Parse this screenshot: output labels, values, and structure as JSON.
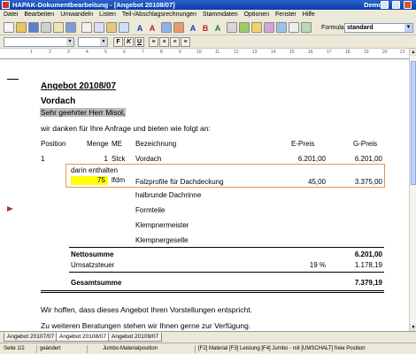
{
  "window": {
    "title": "HAPAK-Dokumentbearbeitung - [Angebot 20108/07]",
    "edition": "Demo"
  },
  "menu": [
    "Datei",
    "Bearbeiten",
    "Umwandeln",
    "Listen",
    "Teil-/Abschlagsrechnungen",
    "Stammdaten",
    "Optionen",
    "Fenster",
    "Hilfe"
  ],
  "toolbar": {
    "formular_label": "Formular",
    "formular_value": "standard",
    "format_buttons": [
      "F",
      "K",
      "U",
      "≡",
      "≡",
      "≡",
      "≡"
    ]
  },
  "ruler_numbers": [
    "1",
    "2",
    "3",
    "4",
    "5",
    "6",
    "7",
    "8",
    "9",
    "10",
    "11",
    "12",
    "13",
    "14",
    "15",
    "16",
    "17",
    "18",
    "19",
    "20",
    "21"
  ],
  "document": {
    "title": "Angebot 20108/07",
    "subject": "Vordach",
    "salutation": "Sehr geehrter Herr Misol,",
    "intro": "wir danken für Ihre Anfrage und bieten wie folgt an:",
    "headers": {
      "position": "Position",
      "quantity": "Menge",
      "unit": "ME",
      "description": "Bezeichnung",
      "unit_price": "E-Preis",
      "total_price": "G-Preis"
    },
    "position1": {
      "position": "1",
      "quantity": "1",
      "unit": "Stck",
      "description": "Vordach",
      "unit_price": "6.201,00",
      "total_price": "6.201,00"
    },
    "included_label": "darin enthalten",
    "subposition": {
      "quantity": "75",
      "unit": "lfdm",
      "description": "Falzprofile für Dachdeckung",
      "unit_price": "45,00",
      "total_price": "3.375,00"
    },
    "sub_items": [
      "halbrunde Dachrinne",
      "Formteile",
      "Klempnermeister",
      "Klempnergeselle"
    ],
    "totals": {
      "net_label": "Nettosumme",
      "net_value": "6.201,00",
      "vat_label": "Umsatzsteuer",
      "vat_rate": "19 %",
      "vat_value": "1.178,19",
      "gross_label": "Gesamtsumme",
      "gross_value": "7.379,19"
    },
    "closing1": "Wir hoffen, dass dieses Angebot Ihren Vorstellungen entspricht.",
    "closing2": "Zu weiteren Beratungen stehen wir Ihnen gerne zur Verfügung."
  },
  "tabs": [
    "Angebot 20107/07",
    "Angebot 20108/07",
    "Angebot 20109/07"
  ],
  "active_tab": "Angebot 20108/07",
  "status": {
    "page": "Seite 1/2",
    "state": "geändert",
    "mode": "Jumbo-Materialposition",
    "hint": "[F2] Material  [F3] Leistung  [F4] Jumbo - mit [UMSCHALT] freie Position"
  }
}
